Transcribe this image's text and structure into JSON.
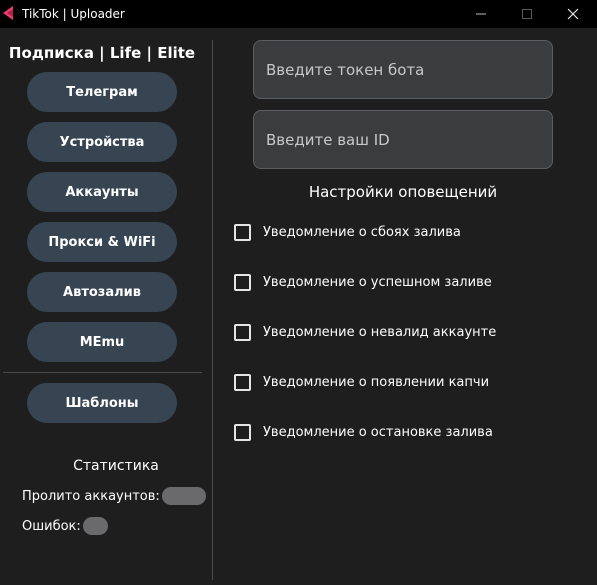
{
  "window": {
    "title": "TikTok | Uploader",
    "minimize_symbol": "—",
    "maximize_symbol": "☐",
    "close_symbol": "✕"
  },
  "sidebar": {
    "subscription_title": "Подписка | Life | Elite",
    "buttons": [
      {
        "label": "Телеграм"
      },
      {
        "label": "Устройства"
      },
      {
        "label": "Аккаунты"
      },
      {
        "label": "Прокси & WiFi"
      },
      {
        "label": "Автозалив"
      },
      {
        "label": "MEmu"
      }
    ],
    "templates_button": "Шаблоны",
    "stats": {
      "title": "Статистика",
      "accounts_label": "Пролито аккаунтов:",
      "accounts_value": "",
      "errors_label": "Ошибок:",
      "errors_value": ""
    }
  },
  "main": {
    "token_field": {
      "placeholder": "Введите токен бота",
      "value": ""
    },
    "id_field": {
      "placeholder": "Введите ваш ID",
      "value": ""
    },
    "notifications_title": "Настройки оповещений",
    "notifications": [
      {
        "label": "Уведомление о сбоях залива",
        "checked": false
      },
      {
        "label": "Уведомление о успешном заливе",
        "checked": false
      },
      {
        "label": "Уведомление о невалид аккаунте",
        "checked": false
      },
      {
        "label": "Уведомление о появлении капчи",
        "checked": false
      },
      {
        "label": "Уведомление о остановке залива",
        "checked": false
      }
    ]
  },
  "colors": {
    "background": "#1e1e1f",
    "titlebar": "#000000",
    "sidebar_button": "#374553",
    "input_background": "#3b3c3e",
    "app_icon": "#e8426a"
  },
  "icons": {
    "app": "tiktok-arrow-icon",
    "checkbox": "empty-checkbox"
  }
}
